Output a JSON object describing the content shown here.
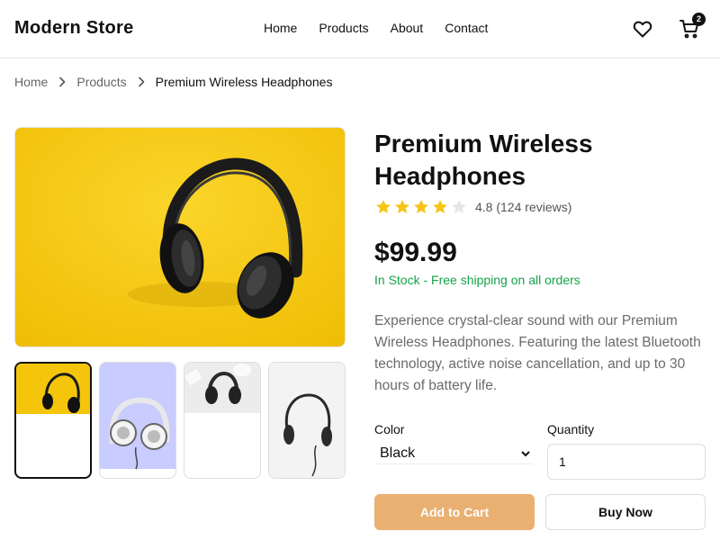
{
  "header": {
    "brand": "Modern Store",
    "nav": [
      "Home",
      "Products",
      "About",
      "Contact"
    ],
    "cart_count": "2"
  },
  "breadcrumb": {
    "items": [
      "Home",
      "Products"
    ],
    "current": "Premium Wireless Headphones"
  },
  "product": {
    "title": "Premium Wireless Headphones",
    "rating_value": 4.8,
    "rating_text": "4.8 (124 reviews)",
    "stars_filled": 4,
    "stars_total": 5,
    "price": "$99.99",
    "stock": "In Stock - Free shipping on all orders",
    "description": "Experience crystal-clear sound with our Premium Wireless Headphones. Featuring the latest Bluetooth technology, active noise cancellation, and up to 30 hours of battery life."
  },
  "options": {
    "color_label": "Color",
    "color_value": "Black",
    "quantity_label": "Quantity",
    "quantity_value": "1"
  },
  "actions": {
    "add_to_cart": "Add to Cart",
    "buy_now": "Buy Now"
  },
  "colors": {
    "accent": "#e9b072",
    "stock_green": "#16a34a",
    "star": "#f5c518",
    "main_image_bg": "#f7c90d"
  },
  "icons": {
    "heart": "heart-icon",
    "cart": "cart-icon",
    "chevron": "chevron-right-icon",
    "star": "star-icon"
  }
}
